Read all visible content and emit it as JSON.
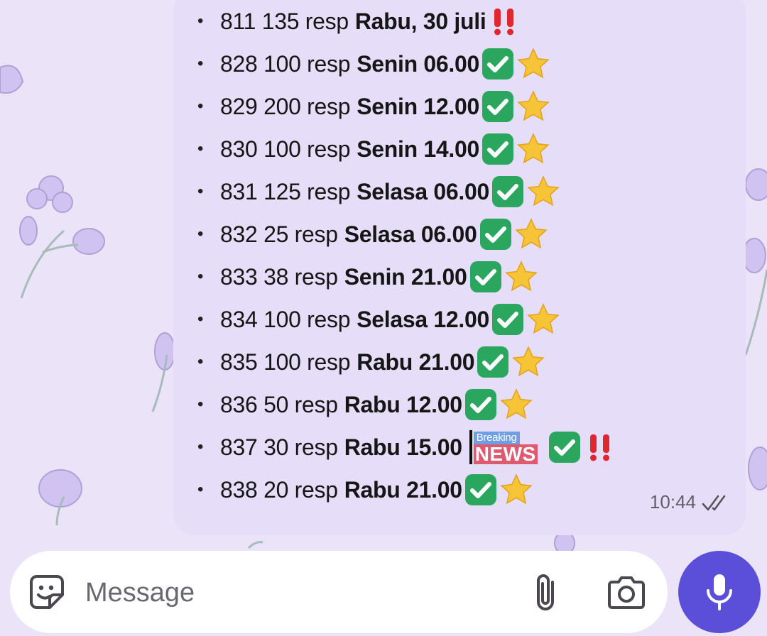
{
  "chat": {
    "messages": [
      {
        "plain": "811 135 resp",
        "bold": "Rabu, 30 juli",
        "marks": [
          "double-exclamation-icon"
        ]
      },
      {
        "plain": "828 100 resp",
        "bold": "Senin 06.00",
        "marks": [
          "check-mark-button-icon",
          "star-icon"
        ]
      },
      {
        "plain": "829 200 resp",
        "bold": "Senin 12.00",
        "marks": [
          "check-mark-button-icon",
          "star-icon"
        ]
      },
      {
        "plain": "830 100 resp",
        "bold": "Senin 14.00",
        "marks": [
          "check-mark-button-icon",
          "star-icon"
        ]
      },
      {
        "plain": "831 125 resp",
        "bold": "Selasa 06.00",
        "marks": [
          "check-mark-button-icon",
          "star-icon"
        ]
      },
      {
        "plain": "832 25 resp",
        "bold": "Selasa 06.00",
        "marks": [
          "check-mark-button-icon",
          "star-icon"
        ]
      },
      {
        "plain": "833 38 resp",
        "bold": "Senin 21.00",
        "marks": [
          "check-mark-button-icon",
          "star-icon"
        ]
      },
      {
        "plain": "834 100 resp",
        "bold": "Selasa 12.00",
        "marks": [
          "check-mark-button-icon",
          "star-icon"
        ]
      },
      {
        "plain": "835 100 resp",
        "bold": "Rabu 21.00",
        "marks": [
          "check-mark-button-icon",
          "star-icon"
        ]
      },
      {
        "plain": "836 50 resp",
        "bold": "Rabu 12.00",
        "marks": [
          "check-mark-button-icon",
          "star-icon"
        ]
      },
      {
        "plain": "837 30 resp",
        "bold": "Rabu 15.00",
        "marks": [
          "breaking-news-sticker",
          "check-mark-button-icon",
          "double-exclamation-icon"
        ]
      },
      {
        "plain": "838 20 resp",
        "bold": "Rabu 21.00",
        "marks": [
          "check-mark-button-icon",
          "star-icon"
        ]
      }
    ],
    "sticker": {
      "top": "Breaking",
      "main": "NEWS"
    },
    "time": "10:44",
    "status_icon": "double-check-read-icon"
  },
  "composer": {
    "placeholder": "Message",
    "sticker_icon": "sticker-smile-icon",
    "attach_icon": "paperclip-icon",
    "camera_icon": "camera-icon",
    "mic_icon": "microphone-icon"
  },
  "colors": {
    "wallpaper": "#ebe3f7",
    "bubble": "#e6def8",
    "accent": "#5b4fd9",
    "check_green": "#2aa65f",
    "star_yellow": "#f6c437",
    "alert_red": "#e0262f"
  }
}
